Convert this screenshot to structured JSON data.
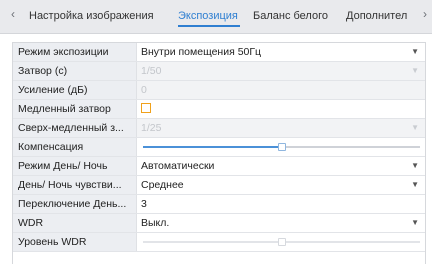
{
  "tabs": [
    {
      "label": "Настройка изображения",
      "active": false
    },
    {
      "label": "Экспозиция",
      "active": true
    },
    {
      "label": "Баланс белого",
      "active": false
    },
    {
      "label": "Дополнител",
      "active": false
    }
  ],
  "rows": {
    "exposure_mode": {
      "label": "Режим экспозиции",
      "value": "Внутри помещения 50Гц"
    },
    "shutter": {
      "label": "Затвор (с)",
      "value": "1/50"
    },
    "gain": {
      "label": "Усиление (дБ)",
      "value": "0"
    },
    "slow_shutter": {
      "label": "Медленный затвор",
      "checked": false
    },
    "super_slow_shutter": {
      "label": "Сверх-медленный з...",
      "value": "1/25"
    },
    "compensation": {
      "label": "Компенсация",
      "level": 0.5
    },
    "day_night_mode": {
      "label": "Режим День/ Ночь",
      "value": "Автоматически"
    },
    "day_night_sensitivity": {
      "label": "День/ Ночь чувстви...",
      "value": "Среднее"
    },
    "day_night_switch": {
      "label": "Переключение День...",
      "value": "3"
    },
    "wdr": {
      "label": "WDR",
      "value": "Выкл."
    },
    "wdr_level": {
      "label": "Уровень WDR",
      "level": 0.5
    }
  },
  "icons": {
    "tab_prev": "chevron-left-icon",
    "tab_next": "chevron-right-icon",
    "dropdown": "caret-down-icon"
  },
  "colors": {
    "accent": "#2f7fd1",
    "checkbox_border": "#f0a11b",
    "label_bg": "#eceef2",
    "disabled_bg": "#f2f3f5"
  }
}
